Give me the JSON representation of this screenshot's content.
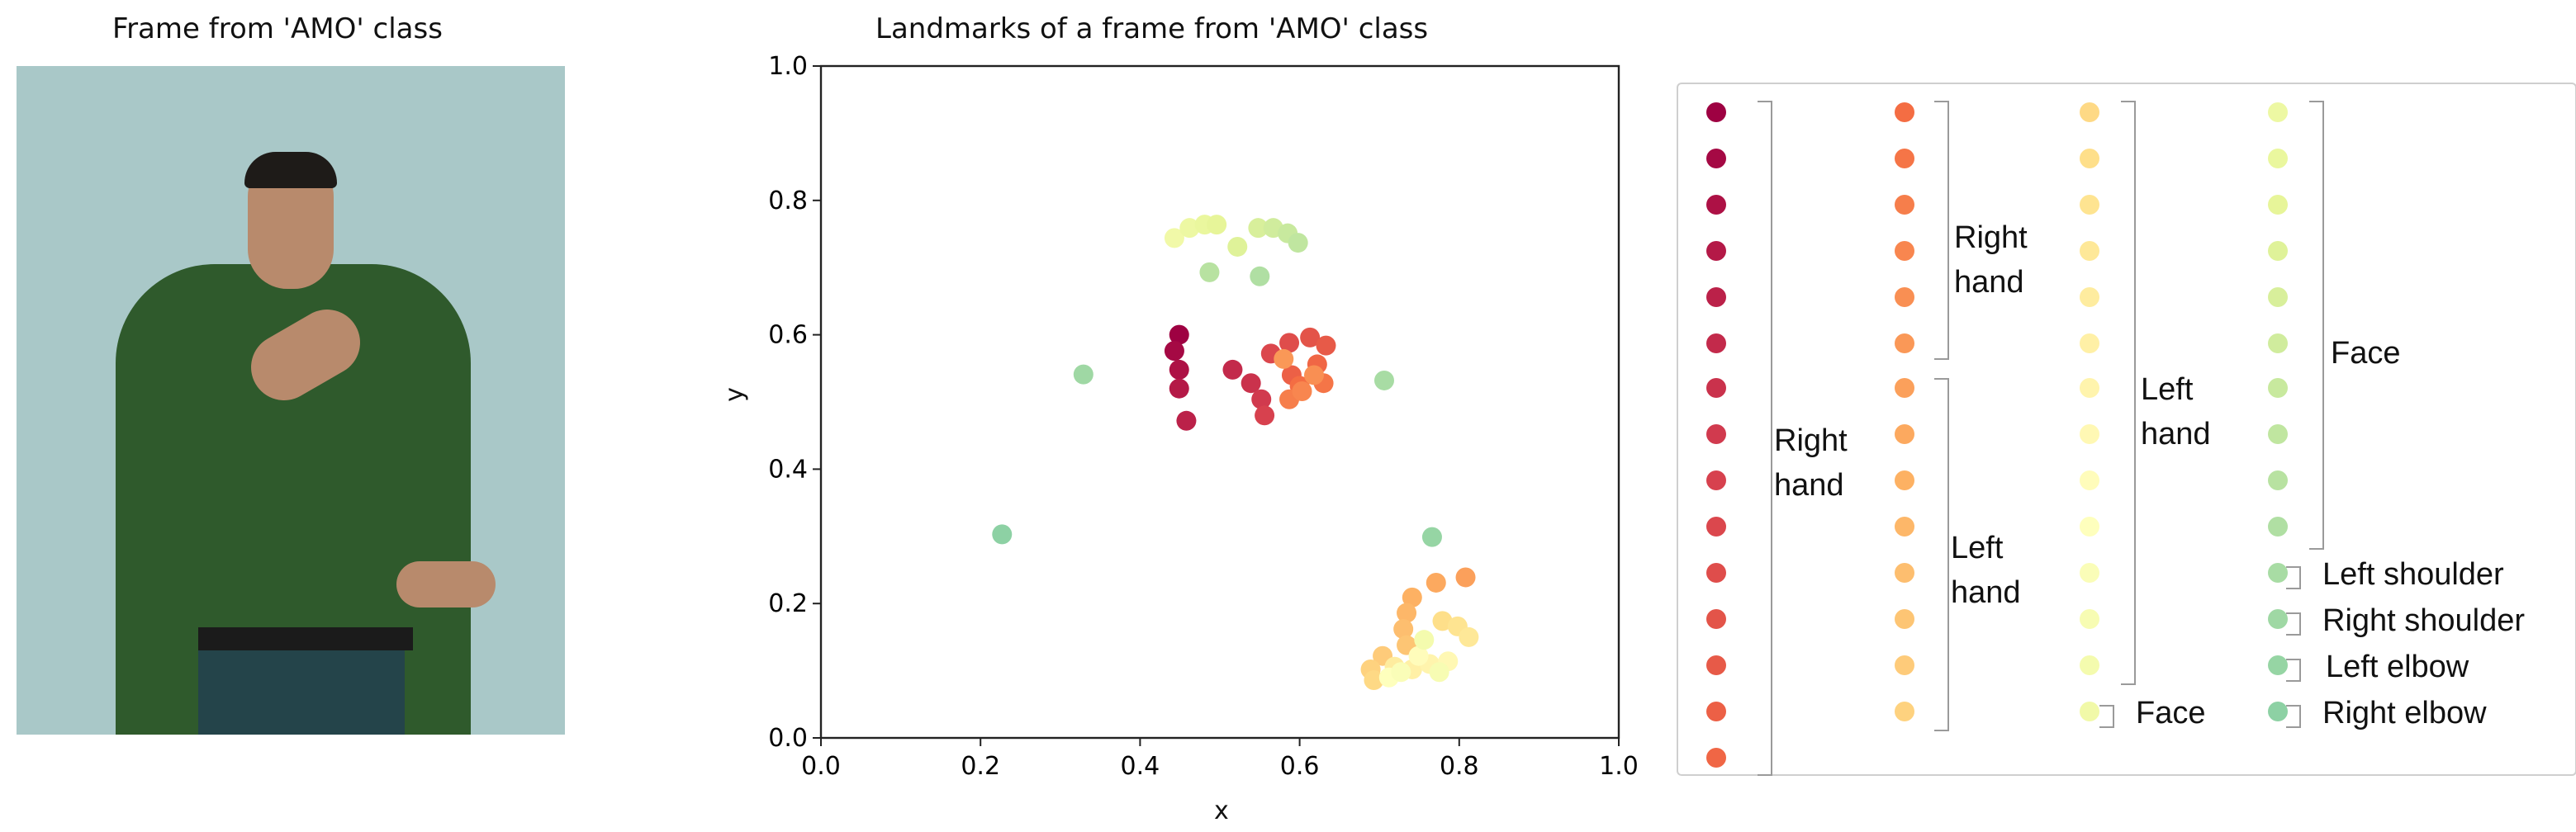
{
  "left_panel": {
    "title": "Frame from 'AMO' class"
  },
  "chart_data": {
    "type": "scatter",
    "title": "Landmarks of a frame from 'AMO' class",
    "xlabel": "x",
    "ylabel": "y",
    "xlim": [
      0,
      1
    ],
    "ylim": [
      0,
      1
    ],
    "xticks": [
      "0.0",
      "0.2",
      "0.4",
      "0.6",
      "0.8",
      "1.0"
    ],
    "yticks": [
      "0.0",
      "0.2",
      "0.4",
      "0.6",
      "0.8",
      "1.0"
    ],
    "grid": false,
    "colormap": "Spectral",
    "groups": [
      {
        "label": "Right hand",
        "points": [
          [
            0.449,
            0.6
          ],
          [
            0.443,
            0.576
          ],
          [
            0.449,
            0.548
          ],
          [
            0.449,
            0.52
          ],
          [
            0.458,
            0.472
          ],
          [
            0.516,
            0.548
          ],
          [
            0.539,
            0.528
          ],
          [
            0.552,
            0.504
          ],
          [
            0.556,
            0.48
          ],
          [
            0.564,
            0.572
          ],
          [
            0.587,
            0.588
          ],
          [
            0.613,
            0.596
          ],
          [
            0.633,
            0.584
          ],
          [
            0.59,
            0.54
          ],
          [
            0.622,
            0.556
          ],
          [
            0.6,
            0.524
          ],
          [
            0.63,
            0.528
          ],
          [
            0.587,
            0.504
          ],
          [
            0.603,
            0.516
          ],
          [
            0.618,
            0.54
          ],
          [
            0.58,
            0.564
          ]
        ]
      },
      {
        "label": "Left hand",
        "points": [
          [
            0.808,
            0.239
          ],
          [
            0.771,
            0.231
          ],
          [
            0.741,
            0.209
          ],
          [
            0.734,
            0.186
          ],
          [
            0.73,
            0.162
          ],
          [
            0.734,
            0.138
          ],
          [
            0.704,
            0.122
          ],
          [
            0.689,
            0.102
          ],
          [
            0.693,
            0.086
          ],
          [
            0.779,
            0.174
          ],
          [
            0.798,
            0.166
          ],
          [
            0.812,
            0.15
          ],
          [
            0.719,
            0.106
          ],
          [
            0.741,
            0.102
          ],
          [
            0.763,
            0.11
          ],
          [
            0.786,
            0.114
          ],
          [
            0.749,
            0.122
          ],
          [
            0.712,
            0.09
          ],
          [
            0.727,
            0.098
          ],
          [
            0.775,
            0.098
          ],
          [
            0.756,
            0.146
          ]
        ]
      },
      {
        "label": "Face",
        "points": [
          [
            0.443,
            0.744
          ],
          [
            0.462,
            0.759
          ],
          [
            0.481,
            0.764
          ],
          [
            0.496,
            0.764
          ],
          [
            0.522,
            0.731
          ],
          [
            0.548,
            0.759
          ],
          [
            0.567,
            0.759
          ],
          [
            0.585,
            0.751
          ],
          [
            0.598,
            0.737
          ],
          [
            0.487,
            0.693
          ],
          [
            0.55,
            0.687
          ]
        ]
      },
      {
        "label": "Left shoulder",
        "points": [
          [
            0.706,
            0.532
          ]
        ]
      },
      {
        "label": "Right shoulder",
        "points": [
          [
            0.329,
            0.541
          ]
        ]
      },
      {
        "label": "Left elbow",
        "points": [
          [
            0.766,
            0.299
          ]
        ]
      },
      {
        "label": "Right elbow",
        "points": [
          [
            0.227,
            0.303
          ]
        ]
      }
    ]
  },
  "legend": {
    "right_hand_1": [
      "Right",
      "hand"
    ],
    "right_hand_2": [
      "Right",
      "hand"
    ],
    "left_hand_1": [
      "Left",
      "hand"
    ],
    "left_hand_2": [
      "Left",
      "hand"
    ],
    "face_1": "Face",
    "face_2": "Face",
    "left_shoulder": "Left shoulder",
    "right_shoulder": "Right shoulder",
    "left_elbow": "Left elbow",
    "right_elbow": "Right elbow"
  }
}
